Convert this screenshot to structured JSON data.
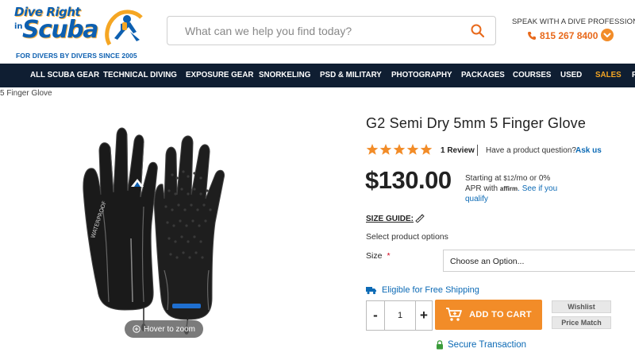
{
  "logo": {
    "line1": "Dive Right",
    "line_in": "in",
    "line2": "Scuba",
    "tagline": "FOR DIVERS BY DIVERS SINCE 2005"
  },
  "search": {
    "placeholder": "What can we help you find today?",
    "icon": "search-icon"
  },
  "contact": {
    "label": "SPEAK WITH A DIVE PROFESSIONAL",
    "phone": "815 267 8400"
  },
  "nav": {
    "items": [
      {
        "label": "ALL SCUBA GEAR"
      },
      {
        "label": "TECHNICAL DIVING"
      },
      {
        "label": "EXPOSURE GEAR"
      },
      {
        "label": "SNORKELING"
      },
      {
        "label": "PSD & MILITARY"
      },
      {
        "label": "PHOTOGRAPHY"
      },
      {
        "label": "PACKAGES"
      },
      {
        "label": "COURSES"
      },
      {
        "label": "USED"
      },
      {
        "label": "SALES"
      },
      {
        "label": "R"
      }
    ]
  },
  "breadcrumb": "5 Finger Glove",
  "gallery": {
    "zoom_label": "Hover to zoom"
  },
  "product": {
    "title": "G2 Semi Dry 5mm 5 Finger Glove",
    "rating": 5,
    "rating_max": 5,
    "reviews": "1 Review",
    "question": "Have a product question?",
    "ask_link": "Ask us",
    "price": "$130.00",
    "afford_prefix": "Starting at ",
    "afford_amount": "$12",
    "afford_mid": "/mo or 0% APR with ",
    "afford_brand": "affirm",
    "afford_link": "See if you qualify",
    "size_guide": "SIZE GUIDE:",
    "select_options": "Select product options",
    "size_label": "Size",
    "size_required": "*",
    "size_value": "Choose an Option...",
    "shipping": "Eligible for Free Shipping",
    "qty_minus": "-",
    "qty_value": "1",
    "qty_plus": "+",
    "add_to_cart": "ADD TO CART",
    "wishlist": "Wishlist",
    "price_match": "Price Match",
    "secure": "Secure Transaction"
  },
  "colors": {
    "brand_blue": "#0c5fb0",
    "nav_bg": "#0f1e32",
    "accent_orange": "#f28c28",
    "link_blue": "#0c6ab5",
    "sales_yellow": "#f5a623"
  }
}
